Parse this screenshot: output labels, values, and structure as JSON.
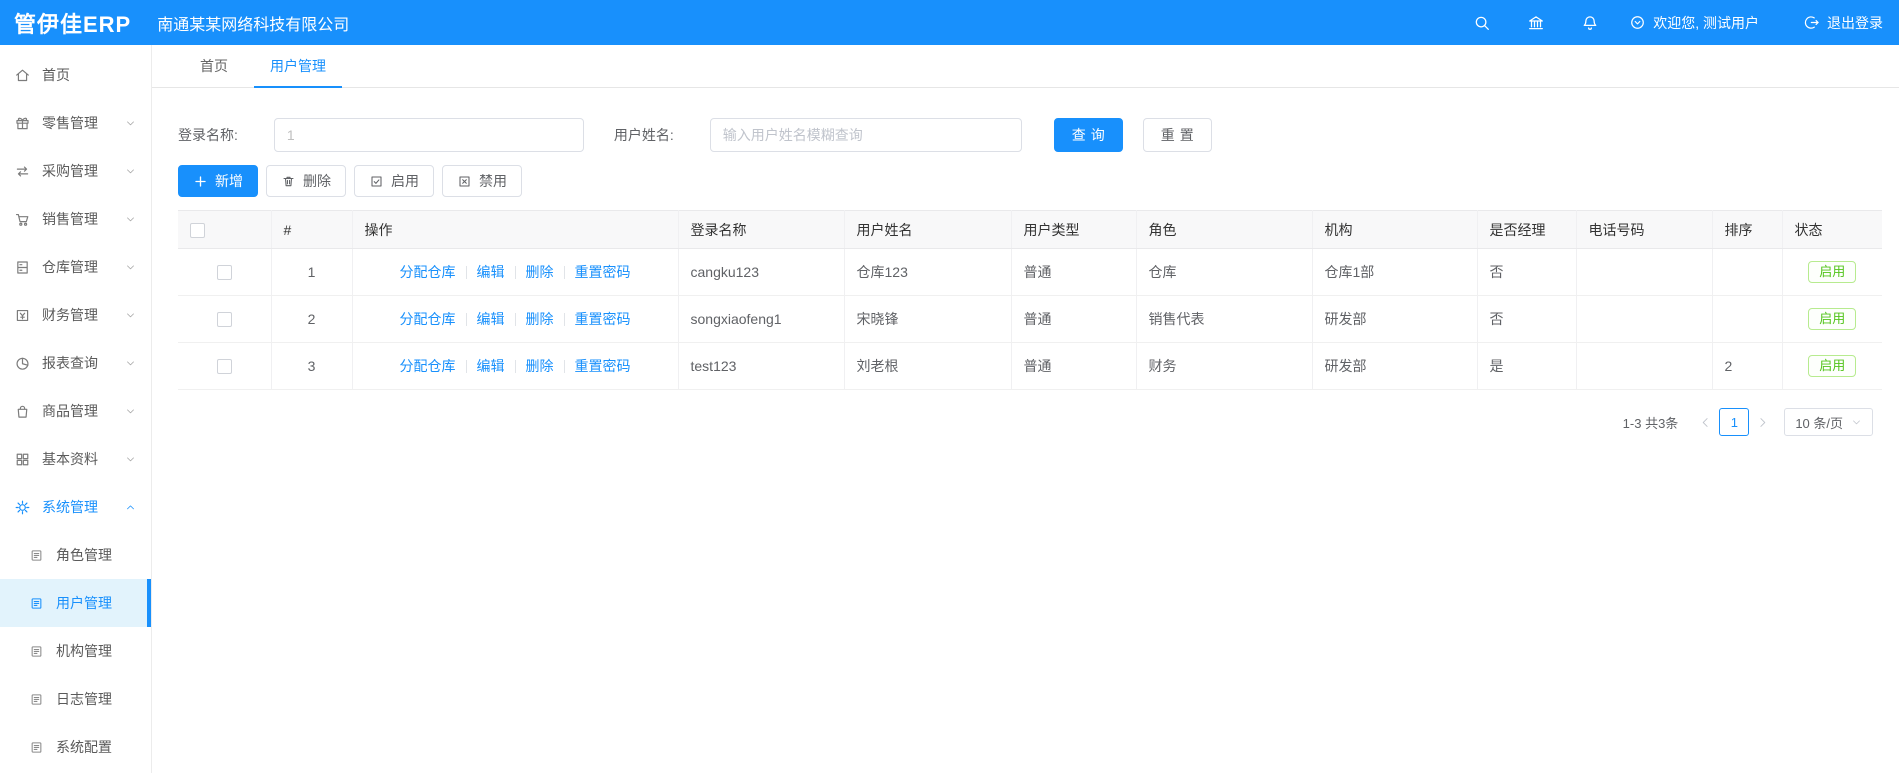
{
  "colors": {
    "accent": "#1890fc",
    "success": "#52c41a",
    "badge_border": "#b7eb8f"
  },
  "topbar": {
    "logo": "管伊佳ERP",
    "company": "南通某某网络科技有限公司",
    "welcome": "欢迎您, 测试用户",
    "logout": "退出登录"
  },
  "tabs": {
    "home": "首页",
    "current": "用户管理"
  },
  "sidebar": {
    "items": [
      {
        "label": "首页"
      },
      {
        "label": "零售管理"
      },
      {
        "label": "采购管理"
      },
      {
        "label": "销售管理"
      },
      {
        "label": "仓库管理"
      },
      {
        "label": "财务管理"
      },
      {
        "label": "报表查询"
      },
      {
        "label": "商品管理"
      },
      {
        "label": "基本资料"
      },
      {
        "label": "系统管理"
      }
    ],
    "subitems": [
      {
        "label": "角色管理"
      },
      {
        "label": "用户管理"
      },
      {
        "label": "机构管理"
      },
      {
        "label": "日志管理"
      },
      {
        "label": "系统配置"
      }
    ]
  },
  "search": {
    "login_label": "登录名称:",
    "login_value": "1",
    "name_label": "用户姓名:",
    "name_placeholder": "输入用户姓名模糊查询",
    "query_button": "查询",
    "reset_button": "重置"
  },
  "toolbar": {
    "add": "新增",
    "delete": "删除",
    "enable": "启用",
    "disable": "禁用"
  },
  "table": {
    "headers": {
      "index": "#",
      "action": "操作",
      "login": "登录名称",
      "name": "用户姓名",
      "type": "用户类型",
      "role": "角色",
      "org": "机构",
      "manager": "是否经理",
      "phone": "电话号码",
      "sort": "排序",
      "status": "状态"
    },
    "action_links": {
      "assign": "分配仓库",
      "edit": "编辑",
      "del": "删除",
      "reset_pwd": "重置密码"
    },
    "rows": [
      {
        "index": "1",
        "login": "cangku123",
        "name": "仓库123",
        "type": "普通",
        "role": "仓库",
        "org": "仓库1部",
        "manager": "否",
        "phone": "",
        "sort": "",
        "status": "启用"
      },
      {
        "index": "2",
        "login": "songxiaofeng1",
        "name": "宋晓锋",
        "type": "普通",
        "role": "销售代表",
        "org": "研发部",
        "manager": "否",
        "phone": "",
        "sort": "",
        "status": "启用"
      },
      {
        "index": "3",
        "login": "test123",
        "name": "刘老根",
        "type": "普通",
        "role": "财务",
        "org": "研发部",
        "manager": "是",
        "phone": "",
        "sort": "2",
        "status": "启用"
      }
    ]
  },
  "pagination": {
    "summary": "1-3 共3条",
    "page": "1",
    "page_size": "10 条/页"
  }
}
